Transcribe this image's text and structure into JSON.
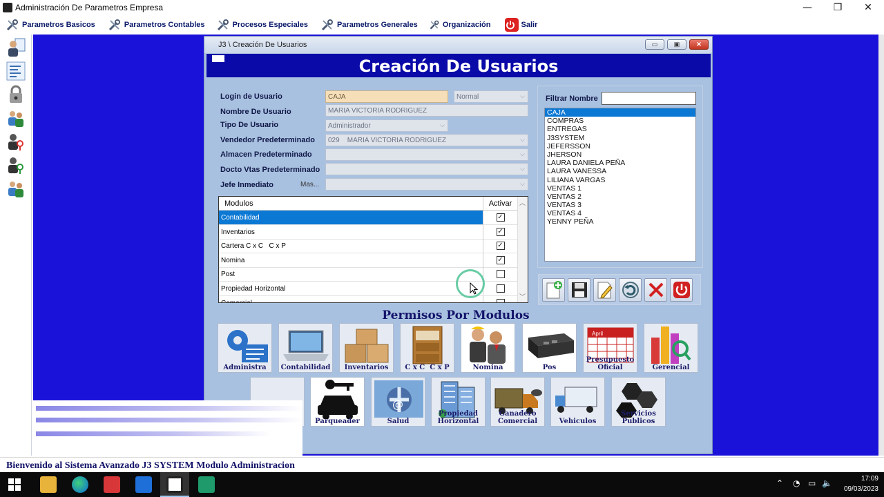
{
  "window": {
    "title": "Administración De Parametros Empresa",
    "minimize": "—",
    "maximize": "❐",
    "close": "✕"
  },
  "menu": [
    {
      "label": "Parametros Basicos"
    },
    {
      "label": "Parametros Contables"
    },
    {
      "label": "Procesos Especiales"
    },
    {
      "label": "Parametros Generales"
    },
    {
      "label": "Organización"
    },
    {
      "label": "Salir"
    }
  ],
  "child": {
    "title": "J3 \\ Creación De Usuarios",
    "headline": "Creación De Usuarios",
    "btn_min": "▭",
    "btn_max": "▣",
    "btn_close": "✕"
  },
  "form": {
    "login_label": "Login de Usuario",
    "login_value": "CAJA",
    "login_type": "Normal",
    "nombre_label": "Nombre De Usuario",
    "nombre_value": "MARIA VICTORIA RODRIGUEZ",
    "tipo_label": "Tipo De Usuario",
    "tipo_value": "Administrador",
    "vendedor_label": "Vendedor Predeterminado",
    "vendedor_value": "029    MARIA VICTORIA RODRIGUEZ",
    "almacen_label": "Almacen Predeterminado",
    "almacen_value": "",
    "docto_label": "Docto Vtas Predeterminado",
    "docto_value": "",
    "jefe_label": "Jefe Inmediato",
    "jefe_more": "Mas...",
    "jefe_value": ""
  },
  "modules_grid": {
    "col_modulos": "Modulos",
    "col_activar": "Activar",
    "rows": [
      {
        "name": "Contabilidad",
        "checked": true,
        "selected": true
      },
      {
        "name": "Inventarios",
        "checked": true,
        "selected": false
      },
      {
        "name": "Cartera C x C   C x P",
        "checked": true,
        "selected": false
      },
      {
        "name": "Nomina",
        "checked": true,
        "selected": false
      },
      {
        "name": "Post",
        "checked": false,
        "selected": false
      },
      {
        "name": "Propiedad Horizontal",
        "checked": false,
        "selected": false
      },
      {
        "name": "Comercial",
        "checked": false,
        "selected": false
      }
    ]
  },
  "filter": {
    "label": "Filtrar Nombre",
    "value": "",
    "users": [
      "CAJA",
      "COMPRAS",
      "ENTREGAS",
      "J3SYSTEM",
      "JEFERSSON",
      "JHERSON",
      "LAURA DANIELA PEÑA",
      "LAURA VANESSA",
      "LILIANA VARGAS",
      "VENTAS 1",
      "VENTAS 2",
      "VENTAS 3",
      "VENTAS 4",
      "YENNY PEÑA"
    ],
    "selected_index": 0
  },
  "permisos": {
    "title": "Permisos Por Modulos",
    "row1": [
      "Administra",
      "Contabilidad",
      "Inventarios",
      "C x C  C x P",
      "Nomina",
      "Pos",
      "Presupuesto Oficial",
      "Gerencial"
    ],
    "row2": [
      "",
      "Parqueader",
      "Salud",
      "Propiedad Horizontal",
      "Ganadero Comercial",
      "Vehiculos",
      "Servicios Publicos"
    ]
  },
  "status": {
    "message": "Bienvenido al Sistema Avanzado J3 SYSTEM Modulo Administracion"
  },
  "taskbar": {
    "time": "17:09",
    "date": "09/03/2023"
  },
  "colors": {
    "mdi_background": "#1a12d9",
    "banner": "#0a0aa8",
    "child_background": "#a9c1e0",
    "selection": "#0b78d4"
  }
}
